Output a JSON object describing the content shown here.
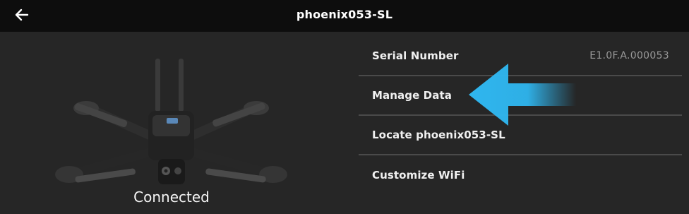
{
  "header": {
    "title": "phoenix053-SL",
    "back_icon": "arrow-left-icon"
  },
  "device": {
    "status": "Connected",
    "image": "drone-image"
  },
  "menu": {
    "serial_number": {
      "label": "Serial Number",
      "value": "E1.0F.A.000053"
    },
    "manage_data": {
      "label": "Manage Data"
    },
    "locate": {
      "label": "Locate phoenix053-SL"
    },
    "customize_wifi": {
      "label": "Customize WiFi"
    }
  },
  "annotation": {
    "icon": "arrow-left-icon",
    "color": "#2fb6ef"
  },
  "colors": {
    "background": "#262626",
    "topbar": "#0d0d0d",
    "divider": "#4a4a4a",
    "accent": "#2fb6ef"
  }
}
